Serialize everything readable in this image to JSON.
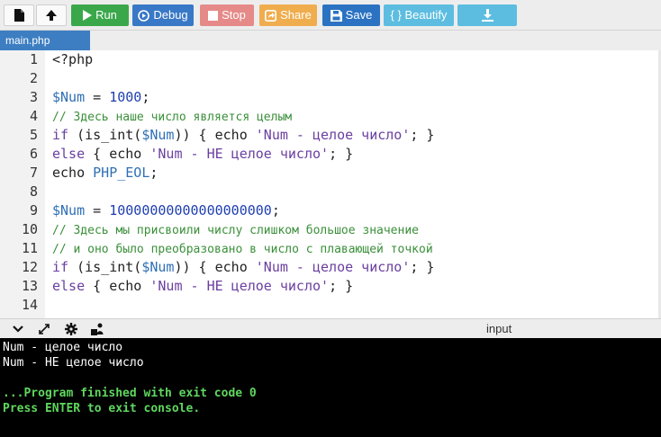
{
  "toolbar": {
    "run_label": "Run",
    "debug_label": "Debug",
    "stop_label": "Stop",
    "share_label": "Share",
    "save_label": "Save",
    "beautify_label": "{ } Beautify",
    "colors": {
      "run": "#3aa84a",
      "debug": "#3978c6",
      "stop": "#e58a88",
      "share": "#f0ad4e",
      "save": "#2b73c2",
      "beautify": "#5cbde0"
    }
  },
  "file_tab": {
    "label": "main.php"
  },
  "editor": {
    "lines": [
      {
        "num": "1",
        "code": "<?php"
      },
      {
        "num": "2",
        "code": ""
      },
      {
        "num": "3",
        "var": "$Num",
        "op": " = ",
        "num_val": "1000",
        "end": ";"
      },
      {
        "num": "4",
        "comment": "// Здесь наше число является целым"
      },
      {
        "num": "5",
        "kw1": "if",
        "p1": " (is_int(",
        "var": "$Num",
        "p2": ")) { echo ",
        "str": "'Num - целое число'",
        "end": "; }"
      },
      {
        "num": "6",
        "kw1": "else",
        "p1": " { echo ",
        "str": "'Num - НЕ целое число'",
        "end": "; }"
      },
      {
        "num": "7",
        "p1": "echo ",
        "const": "PHP_EOL",
        "end": ";"
      },
      {
        "num": "8",
        "code": ""
      },
      {
        "num": "9",
        "var": "$Num",
        "op": " = ",
        "num_val": "10000000000000000000",
        "end": ";"
      },
      {
        "num": "10",
        "comment": "// Здесь мы присвоили числу слишком большое значение"
      },
      {
        "num": "11",
        "comment": "// и оно было преобразовано в число с плавающей точкой"
      },
      {
        "num": "12",
        "kw1": "if",
        "p1": " (is_int(",
        "var": "$Num",
        "p2": ")) { echo ",
        "str": "'Num - целое число'",
        "end": "; }"
      },
      {
        "num": "13",
        "kw1": "else",
        "p1": " { echo ",
        "str": "'Num - НЕ целое число'",
        "end": "; }"
      },
      {
        "num": "14",
        "code": ""
      }
    ]
  },
  "console_bar": {
    "input_label": "input"
  },
  "console": {
    "lines": [
      {
        "text": "Num - целое число",
        "kind": "out"
      },
      {
        "text": "Num - НЕ целое число",
        "kind": "out"
      },
      {
        "text": "",
        "kind": "out"
      },
      {
        "text": "...Program finished with exit code 0",
        "kind": "sys"
      },
      {
        "text": "Press ENTER to exit console.",
        "kind": "sys"
      }
    ]
  },
  "icons": {
    "file": "new-file-icon",
    "upload": "upload-icon",
    "run": "play-icon",
    "debug": "debug-icon",
    "stop": "stop-icon",
    "share": "share-icon",
    "save": "save-icon",
    "download": "download-icon"
  }
}
